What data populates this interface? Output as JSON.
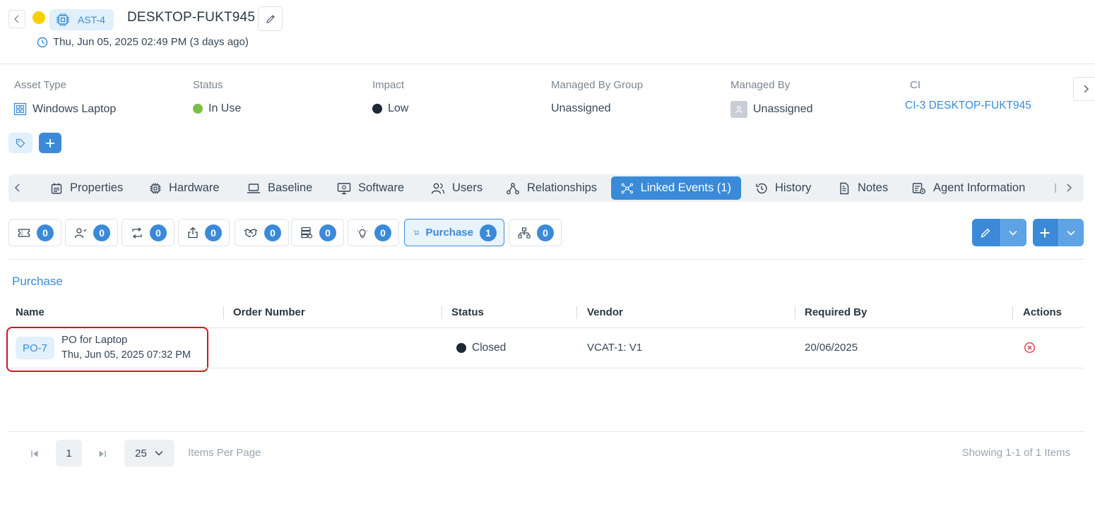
{
  "header": {
    "asset_id": "AST-4",
    "title": "DESKTOP-FUKT945",
    "created": "Thu, Jun 05, 2025 02:49 PM (3 days ago)",
    "status_color": "#f8d000"
  },
  "fields": {
    "asset_type": {
      "label": "Asset Type",
      "value": "Windows Laptop"
    },
    "status": {
      "label": "Status",
      "value": "In Use",
      "color": "#7cbf44"
    },
    "impact": {
      "label": "Impact",
      "value": "Low",
      "color": "#1c2a38"
    },
    "managed_by_group": {
      "label": "Managed By Group",
      "value": "Unassigned"
    },
    "managed_by": {
      "label": "Managed By",
      "value": "Unassigned"
    },
    "ci": {
      "label": "CI",
      "value": "CI-3 DESKTOP-FUKT945"
    }
  },
  "tabs": [
    {
      "label": "Properties",
      "icon": "calendar-icon"
    },
    {
      "label": "Hardware",
      "icon": "chip-icon"
    },
    {
      "label": "Baseline",
      "icon": "laptop-icon"
    },
    {
      "label": "Software",
      "icon": "monitor-icon"
    },
    {
      "label": "Users",
      "icon": "users-icon"
    },
    {
      "label": "Relationships",
      "icon": "relationships-icon"
    },
    {
      "label": "Linked Events (1)",
      "icon": "linked-events-icon",
      "active": true
    },
    {
      "label": "History",
      "icon": "history-icon"
    },
    {
      "label": "Notes",
      "icon": "notes-icon"
    },
    {
      "label": "Agent Information",
      "icon": "agent-info-icon"
    }
  ],
  "event_filters": [
    {
      "icon": "ticket-icon",
      "count": "0"
    },
    {
      "icon": "user-request-icon",
      "count": "0"
    },
    {
      "icon": "change-icon",
      "count": "0"
    },
    {
      "icon": "release-icon",
      "count": "0"
    },
    {
      "icon": "handshake-icon",
      "count": "0"
    },
    {
      "icon": "asset-db-icon",
      "count": "0"
    },
    {
      "icon": "idea-icon",
      "count": "0"
    },
    {
      "icon": "cart-icon",
      "label": "Purchase",
      "count": "1",
      "active": true
    },
    {
      "icon": "hierarchy-icon",
      "count": "0"
    }
  ],
  "section_title": "Purchase",
  "table": {
    "columns": [
      "Name",
      "Order Number",
      "Status",
      "Vendor",
      "Required By",
      "Actions"
    ],
    "rows": [
      {
        "id": "PO-7",
        "name": "PO for Laptop",
        "date": "Thu, Jun 05, 2025 07:32 PM",
        "order_number": "",
        "status": "Closed",
        "vendor": "VCAT-1: V1",
        "required_by": "20/06/2025"
      }
    ]
  },
  "pagination": {
    "page": "1",
    "per_page": "25",
    "per_page_label": "Items Per Page",
    "summary": "Showing 1-1 of 1 Items"
  }
}
